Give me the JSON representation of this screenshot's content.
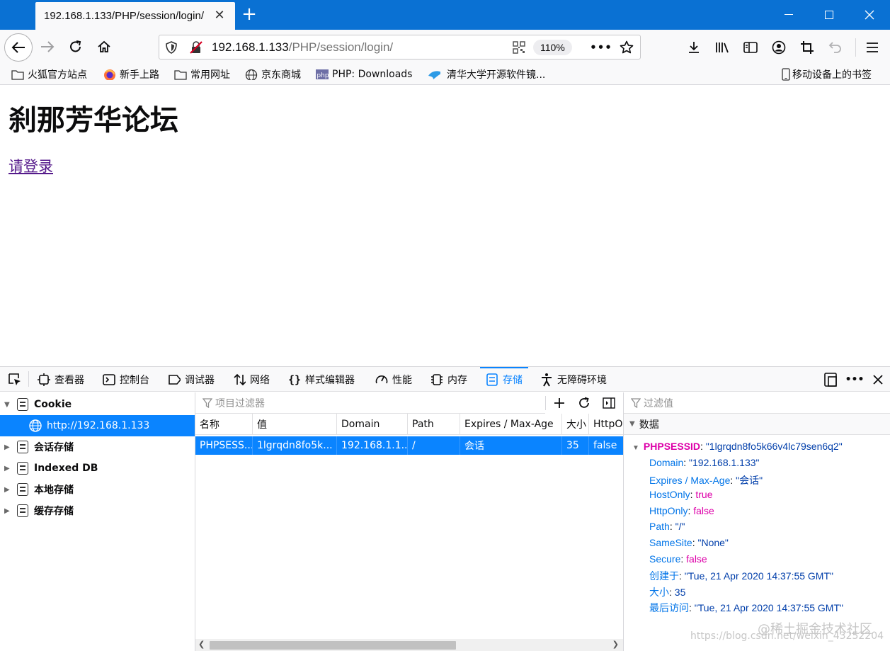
{
  "window": {
    "tab_title": "192.168.1.133/PHP/session/login/",
    "tab_close": "✕",
    "new_tab": "+",
    "minimize": "—",
    "maximize": "☐",
    "close": "✕"
  },
  "navbar": {
    "url_host": "192.168.1.133",
    "url_path": "/PHP/session/login/",
    "zoom": "110%",
    "more": "•••"
  },
  "bookmarks": {
    "items": [
      {
        "label": "火狐官方站点",
        "icon": "folder-icon"
      },
      {
        "label": "新手上路",
        "icon": "firefox-icon"
      },
      {
        "label": "常用网址",
        "icon": "folder-icon"
      },
      {
        "label": "京东商城",
        "icon": "globe-icon"
      },
      {
        "label": "PHP: Downloads",
        "icon": "php-icon"
      },
      {
        "label": "清华大学开源软件镜...",
        "icon": "tuna-icon"
      }
    ],
    "mobile": "移动设备上的书签"
  },
  "page": {
    "heading": "刹那芳华论坛",
    "login_link": "请登录"
  },
  "devtools": {
    "tabs": [
      {
        "label": "查看器",
        "icon": "inspector-icon"
      },
      {
        "label": "控制台",
        "icon": "console-icon"
      },
      {
        "label": "调试器",
        "icon": "debugger-icon"
      },
      {
        "label": "网络",
        "icon": "network-icon"
      },
      {
        "label": "样式编辑器",
        "icon": "style-editor-icon"
      },
      {
        "label": "性能",
        "icon": "performance-icon"
      },
      {
        "label": "内存",
        "icon": "memory-icon"
      },
      {
        "label": "存储",
        "icon": "storage-icon"
      },
      {
        "label": "无障碍环境",
        "icon": "accessibility-icon"
      }
    ],
    "active_tab": "存储",
    "tree": {
      "cookie": "Cookie",
      "cookie_host": "http://192.168.1.133",
      "session_storage": "会话存储",
      "indexed_db": "Indexed DB",
      "local_storage": "本地存储",
      "cache_storage": "缓存存储"
    },
    "table": {
      "filter_placeholder": "项目过滤器",
      "columns": [
        "名称",
        "值",
        "Domain",
        "Path",
        "Expires / Max-Age",
        "大小",
        "HttpO"
      ],
      "rows": [
        [
          "PHPSESS...",
          "1lgrqdn8fo5k...",
          "192.168.1.1...",
          "/",
          "会话",
          "35",
          "false"
        ]
      ]
    },
    "sidebar": {
      "filter_placeholder": "过滤值",
      "section": "数据",
      "name": "PHPSESSID",
      "value": "\"1lgrqdn8fo5k66v4lc79sen6q2\"",
      "entries": [
        {
          "key": "Domain",
          "value": "\"192.168.1.133\"",
          "type": "s"
        },
        {
          "key": "Expires / Max-Age",
          "value": "\"会话\"",
          "type": "s"
        },
        {
          "key": "HostOnly",
          "value": "true",
          "type": "b"
        },
        {
          "key": "HttpOnly",
          "value": "false",
          "type": "b"
        },
        {
          "key": "Path",
          "value": "\"/\"",
          "type": "s"
        },
        {
          "key": "SameSite",
          "value": "\"None\"",
          "type": "s"
        },
        {
          "key": "Secure",
          "value": "false",
          "type": "b"
        },
        {
          "key": "创建于",
          "value": "\"Tue, 21 Apr 2020 14:37:55 GMT\"",
          "type": "s"
        },
        {
          "key": "大小",
          "value": "35",
          "type": "n"
        },
        {
          "key": "最后访问",
          "value": "\"Tue, 21 Apr 2020 14:37:55 GMT\"",
          "type": "s"
        }
      ]
    }
  },
  "watermark": {
    "line1": "@稀土掘金技术社区",
    "line2": "https://blog.csdn.net/weixin_43252204"
  },
  "colors": {
    "titlebar": "#0a71d3",
    "accent": "#0a84ff"
  }
}
